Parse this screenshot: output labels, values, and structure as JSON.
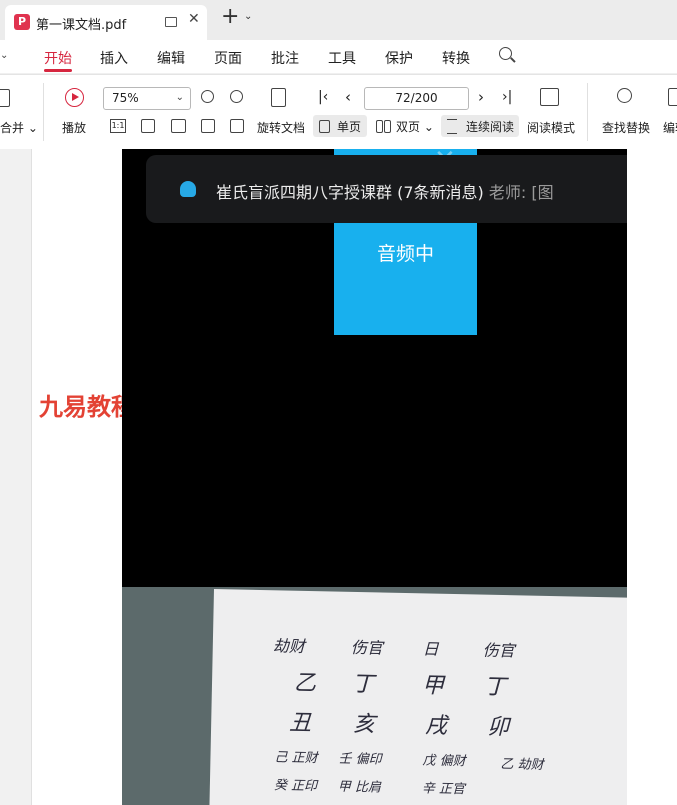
{
  "tab": {
    "title": "第一课文档.pdf",
    "close": "✕",
    "new_tab": "+",
    "new_tab_menu": "⌄"
  },
  "menu": {
    "items": [
      "开始",
      "插入",
      "编辑",
      "页面",
      "批注",
      "工具",
      "保护",
      "转换"
    ],
    "active": "开始"
  },
  "toolbar": {
    "merge": "合并",
    "play": "播放",
    "zoom": "75%",
    "page": "72/200",
    "rotate": "旋转文档",
    "single": "单页",
    "double": "双页",
    "continuous": "连续阅读",
    "read_mode": "阅读模式",
    "find_replace": "查找替换",
    "edit": "编辑"
  },
  "watermark": "九易教程",
  "screenshot": {
    "notification": {
      "group": "崔氏盲派四期八字授课群 (7条新消息)",
      "sender": "老师: [图"
    },
    "audio_label": "音频中",
    "notes": {
      "row1": [
        "劫财",
        "伤官",
        "日",
        "伤官"
      ],
      "row2": [
        "乙",
        "丁",
        "甲",
        "丁"
      ],
      "row3": [
        "丑",
        "亥",
        "戌",
        "卯"
      ],
      "row4": [
        "己 正财",
        "壬 偏印",
        "戊 偏财",
        "乙 劫财"
      ],
      "row5": [
        "癸 正印",
        "甲 比肩",
        "辛 正官"
      ]
    }
  },
  "colors": {
    "accent": "#d6263f",
    "qq_blue": "#18b0ee",
    "watermark": "#e34234"
  }
}
